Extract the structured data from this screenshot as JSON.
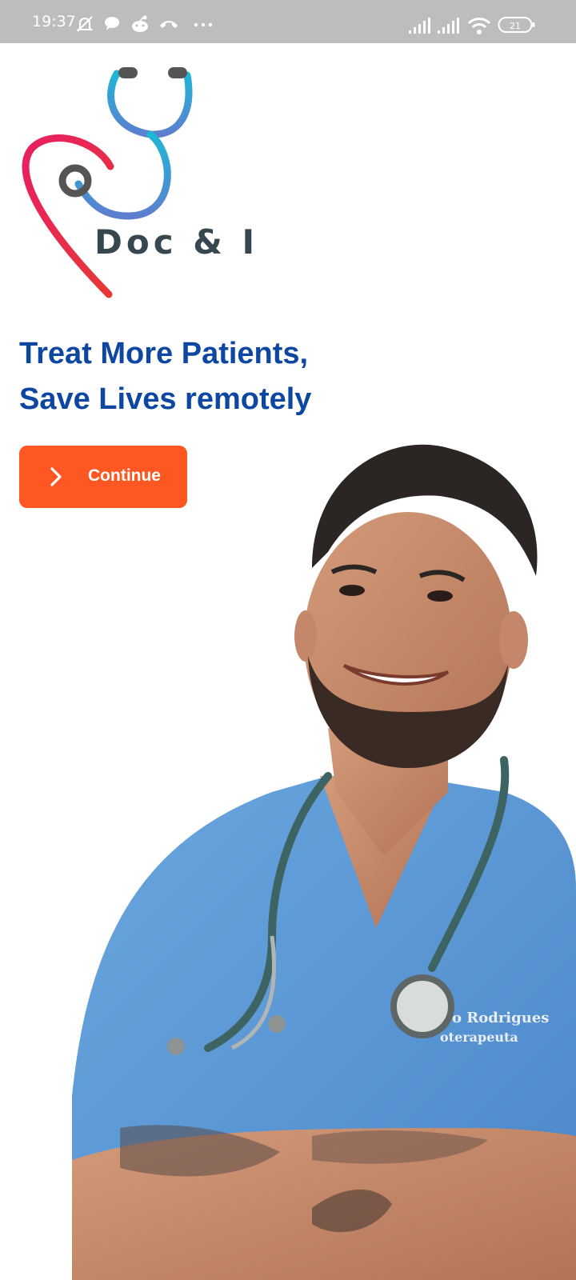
{
  "status_bar": {
    "time": "19:37",
    "left_icons": [
      "bell-off-icon",
      "chat-bubble-icon",
      "reddit-icon",
      "missed-call-icon",
      "more-dots-icon"
    ],
    "right_icons": [
      "signal-icon",
      "signal-icon-2",
      "wifi-icon",
      "battery-icon"
    ],
    "battery_level": "21"
  },
  "logo": {
    "text": "Doc & I"
  },
  "headline": {
    "line1": "Treat More Patients,",
    "line2": "Save Lives remotely"
  },
  "continue_button": {
    "label": "Continue",
    "icon": "chevron-right-icon"
  },
  "photo": {
    "badge_line1": "o Rodrigues",
    "badge_line2": "oterapeuta"
  },
  "colors": {
    "status_bar": "#bdbdbd",
    "headline": "#0d47a1",
    "button": "#ff5722",
    "logo_text": "#37474f",
    "scrubs": "#5b9ad6"
  }
}
